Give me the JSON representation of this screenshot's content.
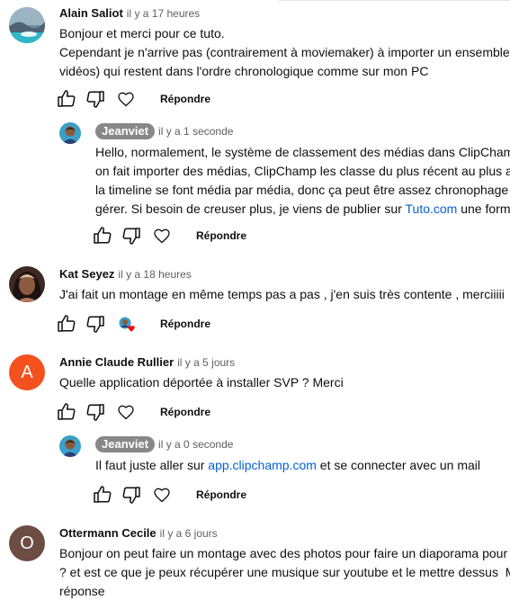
{
  "comments": [
    {
      "author": "Alain Saliot",
      "time": "il y a 17 heures",
      "lines": [
        "Bonjour et merci pour ce tuto.",
        "Cependant je n'arrive pas (contrairement à moviemaker) à importer un ensemble",
        "vidéos) qui restent dans l'ordre chronologique comme sur mon PC"
      ],
      "reply_label": "Répondre"
    },
    {
      "author": "Jeanviet",
      "time": "il y a 1 seconde",
      "lines": [
        "Hello, normalement, le système de classement des médias dans ClipCham",
        "on fait importer des médias, ClipChamp les classe du plus récent au plus a",
        "la timeline se font média par média, donc ça peut être assez chronophage",
        "gérer. Si besoin de creuser plus, je viens de publier sur "
      ],
      "link_text": "Tuto.com",
      "after_link": " une forma",
      "reply_label": "Répondre"
    },
    {
      "author": "Kat Seyez",
      "time": "il y a 18 heures",
      "lines": [
        "J'ai fait un montage en même temps pas a pas , j'en suis très contente , merciiiii"
      ],
      "reply_label": "Répondre"
    },
    {
      "author": "Annie Claude Rullier",
      "time": "il y a 5 jours",
      "avatar_letter": "A",
      "avatar_color": "#f4511e",
      "lines": [
        "Quelle application déportée à installer SVP ? Merci"
      ],
      "reply_label": "Répondre"
    },
    {
      "author": "Jeanviet",
      "time": "il y a 0 seconde",
      "before_link": "Il faut juste aller sur ",
      "link_text": "app.clipchamp.com",
      "after_link": " et se connecter avec un mail",
      "reply_label": "Répondre"
    },
    {
      "author": "Ottermann Cecile",
      "time": "il y a 6 jours",
      "avatar_letter": "O",
      "avatar_color": "#6d4c41",
      "lines": [
        "Bonjour on peut faire un montage avec des photos pour faire un diaporama pour (",
        "? et est ce que je peux récupérer une musique sur youtube et le mettre dessus  M",
        "réponse"
      ]
    }
  ],
  "icons": {
    "like": "thumb-up-icon",
    "dislike": "thumb-down-icon",
    "heart": "heart-outline-icon",
    "creator_heart": "creator-heart-icon"
  },
  "colors": {
    "link": "#065fd4",
    "secondary_text": "#606060",
    "heart_red": "#ff0000",
    "chip_bg": "#888888"
  }
}
